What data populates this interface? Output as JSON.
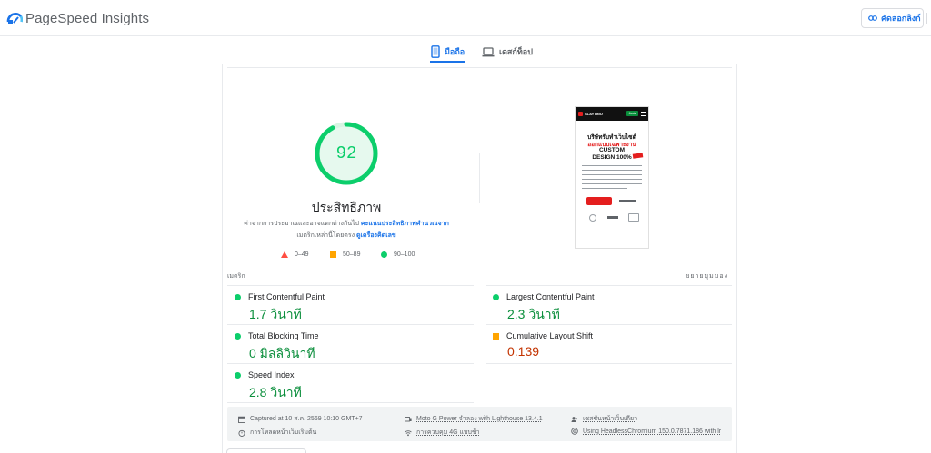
{
  "header": {
    "brand": "PageSpeed Insights",
    "copy_link_label": "คัดลอกลิงก์"
  },
  "tabs": [
    {
      "label": "มือถือ",
      "active": true
    },
    {
      "label": "เดสก์ท็อป",
      "active": false
    }
  ],
  "performance": {
    "score": "92",
    "score_value": 92,
    "title": "ประสิทธิภาพ",
    "desc_1": "ค่าจากการประมาณและอาจแตกต่างกันไป ",
    "desc_link_1": "คะแนนประสิทธิภาพคำนวณจาก",
    "desc_2": "เมตริกเหล่านี้โดยตรง ",
    "desc_link_2": "ดูเครื่องคิดเลข"
  },
  "legend": {
    "fail": "0–49",
    "average": "50–89",
    "pass": "90–100"
  },
  "thumbnail": {
    "brand": "SLAYTINO",
    "cta": "ติดต่อ",
    "line1": "บริษัทรับทำเว็บไซต์",
    "line2": "ออกแบบเฉพาะงาน",
    "line3": "CUSTOM",
    "line4": "DESIGN 100%"
  },
  "metrics": {
    "section_label": "เมตริก",
    "expand_label": "ขยายมุมมอง",
    "items": [
      {
        "name": "First Contentful Paint",
        "value": "1.7 วินาที",
        "status": "good"
      },
      {
        "name": "Largest Contentful Paint",
        "value": "2.3 วินาที",
        "status": "good"
      },
      {
        "name": "Total Blocking Time",
        "value": "0 มิลลิวินาที",
        "status": "good"
      },
      {
        "name": "Cumulative Layout Shift",
        "value": "0.139",
        "status": "average"
      },
      {
        "name": "Speed Index",
        "value": "2.8 วินาที",
        "status": "good"
      }
    ]
  },
  "info": {
    "captured": "Captured at 10 ส.ค. 2569 10:10 GMT+7",
    "initial_load": "การโหลดหน้าเว็บเริ่มต้น",
    "device": "Moto G Power จำลอง with Lighthouse 13.4.1",
    "throttling": "การควบคุม 4G แบบช้า",
    "session": "เซสชันหน้าเว็บเดียว",
    "browser": "Using HeadlessChromium 150.0.7871.186 with lr"
  },
  "colors": {
    "pass": "#0cce6b",
    "average": "#ffa400",
    "fail": "#ff4e42",
    "accent": "#1a73e8"
  }
}
